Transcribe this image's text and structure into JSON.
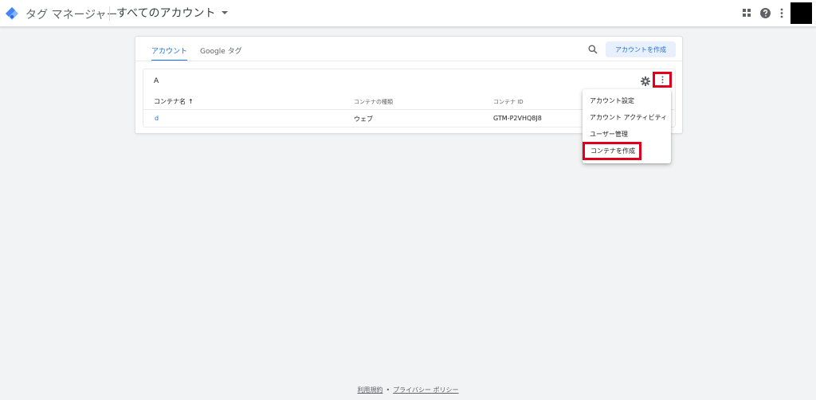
{
  "header": {
    "app_title": "タグ マネージャー",
    "account_switch_label": "すべてのアカウント",
    "icons": [
      "gtm-logo-icon",
      "caret-down-icon",
      "apps-icon",
      "help-icon",
      "more-vert-icon"
    ]
  },
  "tabs": [
    {
      "label": "アカウント",
      "active": true
    },
    {
      "label": "Google タグ",
      "active": false
    }
  ],
  "toolbar": {
    "create_account_label": "アカウントを作成"
  },
  "account": {
    "name": "A",
    "columns": [
      "コンテナ名",
      "コンテナの種類",
      "コンテナ ID"
    ],
    "sort_indicator": "↑",
    "rows": [
      {
        "name": "d",
        "type": "ウェブ",
        "id": "GTM-P2VHQ8J8"
      }
    ]
  },
  "menu": {
    "items": [
      "アカウント設定",
      "アカウント アクティビティ",
      "ユーザー管理",
      "コンテナを作成"
    ]
  },
  "footer": {
    "terms": "利用規約",
    "separator": "•",
    "privacy": "プライバシー ポリシー"
  },
  "colors": {
    "accent": "#1a73e8",
    "highlight_red": "#e0001b",
    "background": "#f1f3f4"
  }
}
